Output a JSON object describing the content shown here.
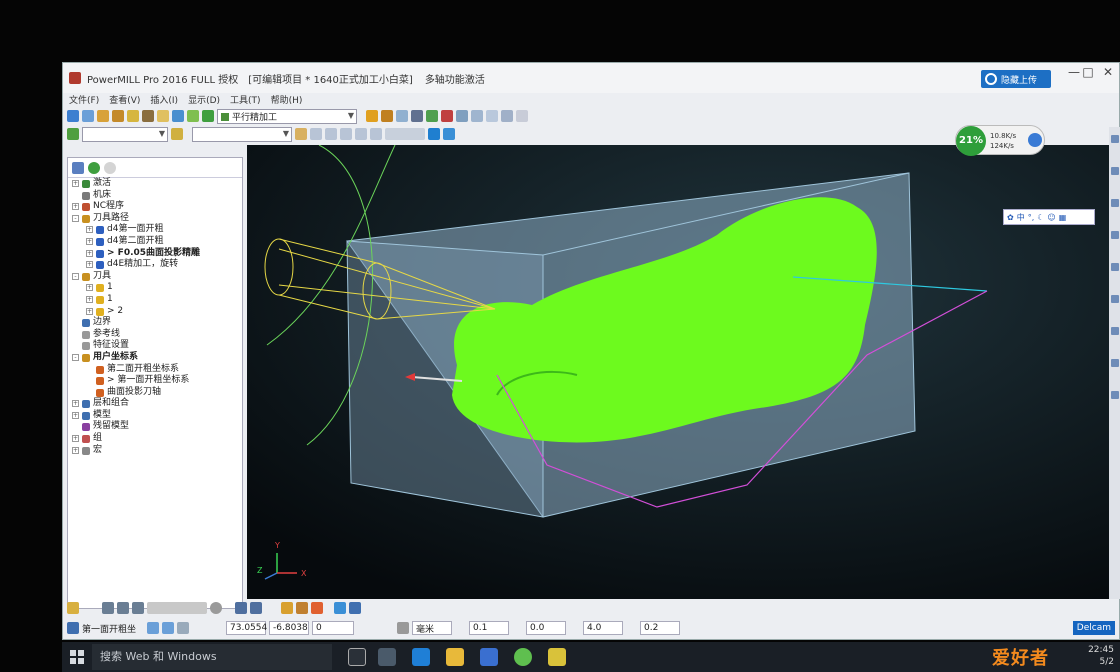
{
  "window": {
    "app_title": "PowerMILL Pro 2016 FULL 授权",
    "project_title": "[可编辑项目 * 1640正式加工小白菜]",
    "mode": "多轴功能激活",
    "cloud_button": "隐藏上传",
    "controls": [
      "—",
      "□",
      "✕"
    ]
  },
  "menu": [
    "文件(F)",
    "查看(V)",
    "插入(I)",
    "显示(D)",
    "工具(T)",
    "帮助(H)"
  ],
  "toolbar": {
    "strategy_combo": "平行精加工"
  },
  "tree": {
    "nodes": [
      {
        "label": "激活",
        "indent": 0,
        "color": "#3a8a3a",
        "exp": "+"
      },
      {
        "label": "机床",
        "indent": 0,
        "color": "#7a7a7a",
        "exp": ""
      },
      {
        "label": "NC程序",
        "indent": 0,
        "color": "#c05030",
        "exp": "+"
      },
      {
        "label": "刀具路径",
        "indent": 0,
        "color": "#c89020",
        "exp": "-"
      },
      {
        "label": "d4第一面开粗",
        "indent": 1,
        "color": "#2d5fbf",
        "exp": "+"
      },
      {
        "label": "d4第二面开粗",
        "indent": 1,
        "color": "#2d5fbf",
        "exp": "+"
      },
      {
        "label": "> F0.05曲面投影精雕",
        "indent": 1,
        "color": "#2d5fbf",
        "exp": "+",
        "bold": true
      },
      {
        "label": "d4E精加工，旋转",
        "indent": 1,
        "color": "#2d5fbf",
        "exp": "+"
      },
      {
        "label": "刀具",
        "indent": 0,
        "color": "#c89020",
        "exp": "-"
      },
      {
        "label": "1",
        "indent": 1,
        "color": "#e0b020",
        "exp": "+"
      },
      {
        "label": "1",
        "indent": 1,
        "color": "#e0b020",
        "exp": "+"
      },
      {
        "label": "> 2",
        "indent": 1,
        "color": "#e0b020",
        "exp": "+"
      },
      {
        "label": "边界",
        "indent": 0,
        "color": "#3f6fb0",
        "exp": ""
      },
      {
        "label": "参考线",
        "indent": 0,
        "color": "#999999",
        "exp": ""
      },
      {
        "label": "特征设置",
        "indent": 0,
        "color": "#999999",
        "exp": ""
      },
      {
        "label": "用户坐标系",
        "indent": 0,
        "color": "#c89020",
        "exp": "-",
        "bold": true
      },
      {
        "label": "第二面开粗坐标系",
        "indent": 1,
        "color": "#d06020",
        "exp": ""
      },
      {
        "label": "> 第一面开粗坐标系",
        "indent": 1,
        "color": "#d06020",
        "exp": ""
      },
      {
        "label": "曲面投影刀轴",
        "indent": 1,
        "color": "#d06020",
        "exp": ""
      },
      {
        "label": "层和组合",
        "indent": 0,
        "color": "#3f6fb0",
        "exp": "+"
      },
      {
        "label": "模型",
        "indent": 0,
        "color": "#3f6fb0",
        "exp": "+"
      },
      {
        "label": "残留模型",
        "indent": 0,
        "color": "#8a40a0",
        "exp": ""
      },
      {
        "label": "组",
        "indent": 0,
        "color": "#c05050",
        "exp": "+"
      },
      {
        "label": "宏",
        "indent": 0,
        "color": "#888888",
        "exp": "+"
      }
    ]
  },
  "net_speed": {
    "percent": "21%",
    "up": "10.8K/s",
    "down": "124K/s"
  },
  "mini_toolbar": {
    "label": "中"
  },
  "axis_triad": {
    "x": "X",
    "y": "Y",
    "z": "Z"
  },
  "status": {
    "workplane": "第一面开粗坐",
    "x": "73.0554",
    "y": "-6.8038",
    "z": "0",
    "units": "毫米",
    "tol": "0.1",
    "thick": "0.0",
    "diameter": "4.0",
    "step": "0.2",
    "brand": "Delcam"
  },
  "taskbar": {
    "search": "搜索 Web 和 Windows",
    "time": "22:45",
    "date": "5/2",
    "brand_text": "爱好者"
  }
}
